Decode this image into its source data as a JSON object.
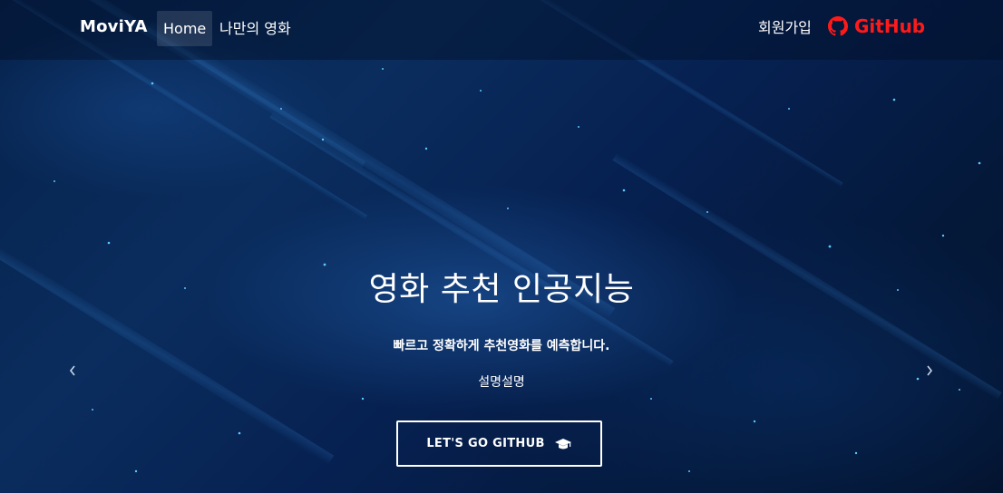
{
  "navbar": {
    "brand": "MoviYA",
    "links": [
      {
        "label": "Home",
        "active": true
      },
      {
        "label": "나만의 영화",
        "active": false
      }
    ],
    "signup_label": "회원가입",
    "github_label": "GitHub",
    "github_icon": "github-icon",
    "github_color": "#ff1a1a"
  },
  "hero": {
    "title": "영화 추천 인공지능",
    "subtitle": "빠르고 정확하게 추천영화를 예측합니다.",
    "description": "설명설명",
    "cta_label": "LET'S GO GITHUB",
    "cta_icon": "graduation-cap-icon"
  },
  "carousel": {
    "prev_icon": "chevron-left-icon",
    "next_icon": "chevron-right-icon"
  },
  "colors": {
    "background": "#06214a",
    "text": "#ffffff"
  }
}
